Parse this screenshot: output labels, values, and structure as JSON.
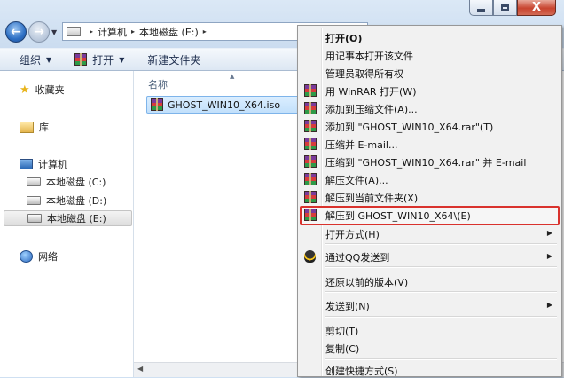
{
  "window": {
    "caption_close": "X"
  },
  "nav": {
    "back_arrow": "←",
    "forward_arrow": "→",
    "dropdown": "▼"
  },
  "address": {
    "separator": "▸",
    "crumbs": [
      "计算机",
      "本地磁盘 (E:)"
    ]
  },
  "toolbar": {
    "organize": "组织",
    "open": "打开",
    "new_folder": "新建文件夹",
    "caret": "▼"
  },
  "sidebar": {
    "favorites": "收藏夹",
    "libraries": "库",
    "computer": "计算机",
    "drive_c": "本地磁盘 (C:)",
    "drive_d": "本地磁盘 (D:)",
    "drive_e": "本地磁盘 (E:)",
    "network": "网络"
  },
  "main": {
    "column_name": "名称",
    "sort_indicator": "▲",
    "file_name": "GHOST_WIN10_X64.iso",
    "scroll_left": "◀"
  },
  "menu": {
    "open": "打开(O)",
    "notepad": "用记事本打开该文件",
    "take_ownership": "管理员取得所有权",
    "winrar_open": "用 WinRAR 打开(W)",
    "add_to_archive": "添加到压缩文件(A)...",
    "add_to_rar": "添加到 \"GHOST_WIN10_X64.rar\"(T)",
    "compress_email": "压缩并 E-mail...",
    "compress_rar_email": "压缩到 \"GHOST_WIN10_X64.rar\" 并 E-mail",
    "extract_files": "解压文件(A)...",
    "extract_here": "解压到当前文件夹(X)",
    "extract_to": "解压到 GHOST_WIN10_X64\\(E)",
    "open_with": "打开方式(H)",
    "send_qq": "通过QQ发送到",
    "restore_previous": "还原以前的版本(V)",
    "send_to": "发送到(N)",
    "cut": "剪切(T)",
    "copy": "复制(C)",
    "create_shortcut": "创建快捷方式(S)",
    "submenu_arrow": "▶"
  },
  "colors": {
    "highlight_border": "#d9322d",
    "selection_blue": "#c2e0fb"
  }
}
